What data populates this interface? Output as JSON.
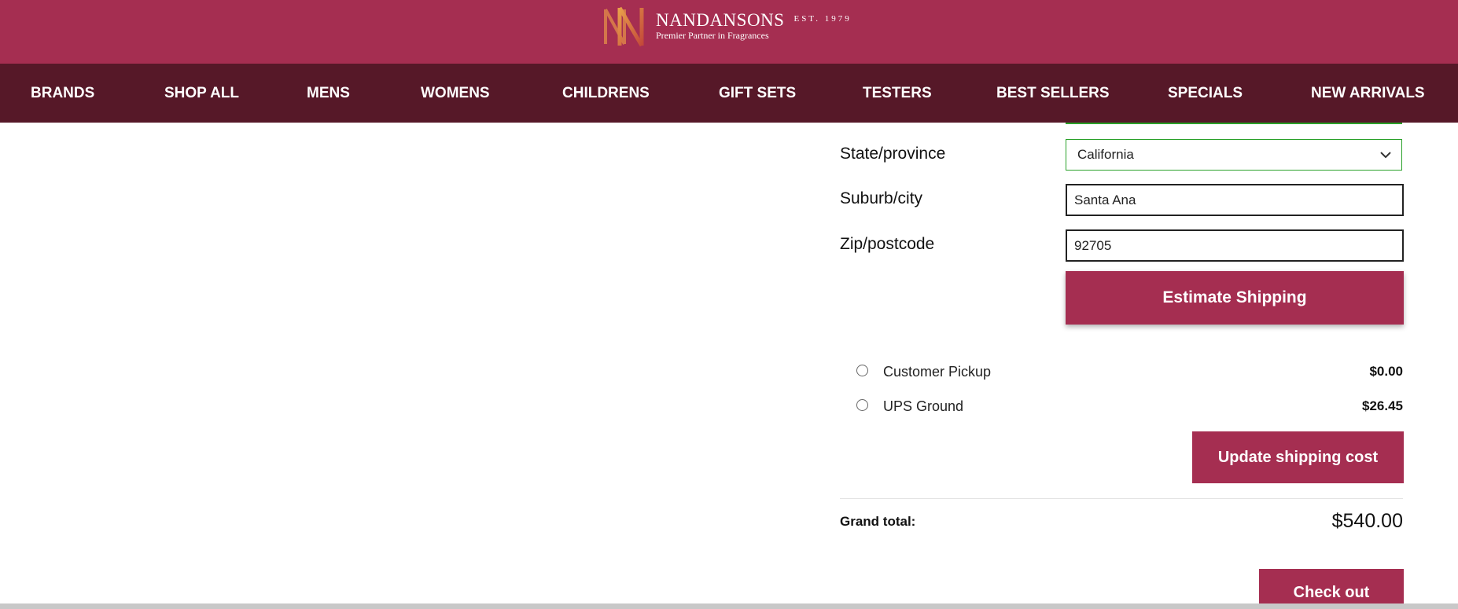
{
  "brand": {
    "name": "NANDANSONS",
    "established": "EST. 1979",
    "tagline": "Premier Partner in Fragrances",
    "colors": {
      "primary": "#a52e51",
      "nav": "#561828",
      "valid": "#2aa12a"
    }
  },
  "nav": {
    "items": [
      "BRANDS",
      "SHOP ALL",
      "MENS",
      "WOMENS",
      "CHILDRENS",
      "GIFT SETS",
      "TESTERS",
      "BEST SELLERS",
      "SPECIALS",
      "NEW ARRIVALS"
    ]
  },
  "shipping_form": {
    "state_label": "State/province",
    "state_value": "California",
    "city_label": "Suburb/city",
    "city_value": "Santa Ana",
    "zip_label": "Zip/postcode",
    "zip_value": "92705",
    "estimate_button": "Estimate Shipping"
  },
  "shipping_options": [
    {
      "label": "Customer Pickup",
      "price": "$0.00"
    },
    {
      "label": "UPS Ground",
      "price": "$26.45"
    }
  ],
  "update_button": "Update shipping cost",
  "grand_total": {
    "label": "Grand total:",
    "value": "$540.00"
  },
  "checkout_button": "Check out"
}
